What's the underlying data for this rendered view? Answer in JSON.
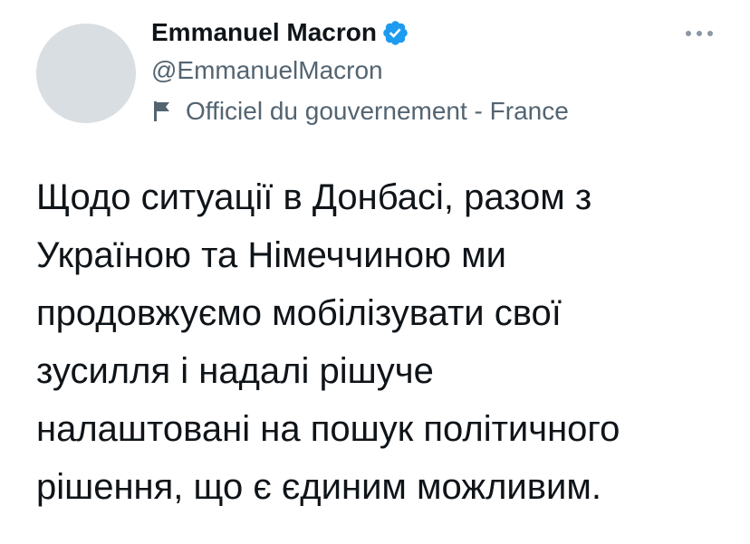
{
  "author": {
    "display_name": "Emmanuel Macron",
    "handle": "@EmmanuelMacron",
    "verified_icon": "verified-badge-icon",
    "label_icon": "flag-icon",
    "label": "Officiel du gouvernement - France"
  },
  "menu": {
    "icon": "more-dots-icon"
  },
  "tweet": {
    "lines": [
      "Щодо ситуації в Донбасі, разом з",
      "Україною та Німеччиною ми",
      "продовжуємо мобілізувати свої",
      "зусилля і надалі рішуче",
      "налаштовані на пошук політичного",
      "рішення, що є єдиним можливим."
    ]
  },
  "colors": {
    "text_primary": "#0f1419",
    "text_secondary": "#536471",
    "verified_blue": "#1d9bf0",
    "avatar_placeholder": "#d9dee3"
  }
}
